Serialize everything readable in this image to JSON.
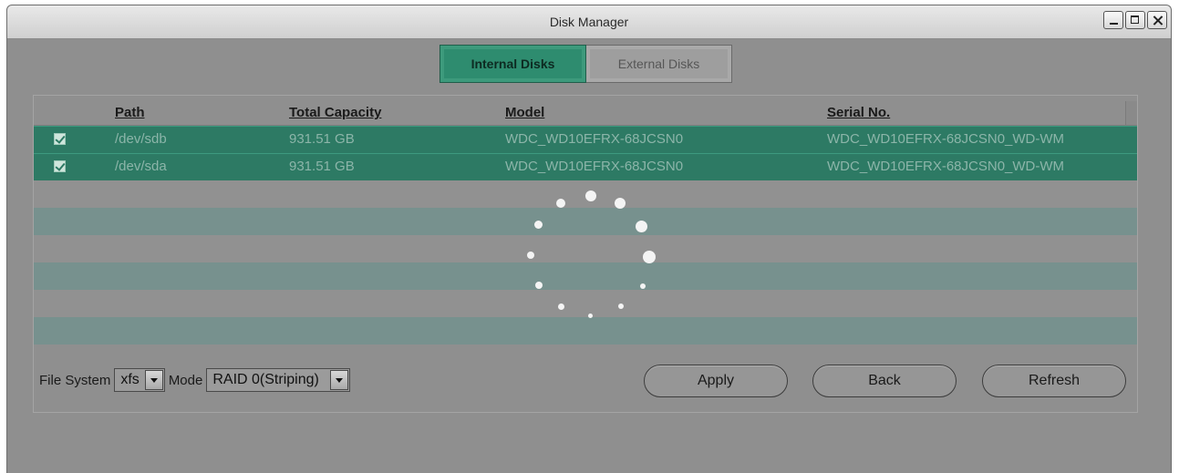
{
  "window": {
    "title": "Disk Manager"
  },
  "tabs": [
    {
      "label": "Internal Disks",
      "active": true
    },
    {
      "label": "External Disks",
      "active": false
    }
  ],
  "table": {
    "columns": [
      "Path",
      "Total Capacity",
      "Model",
      "Serial No."
    ],
    "rows": [
      {
        "checked": true,
        "path": "/dev/sdb",
        "capacity": "931.51 GB",
        "model": "WDC_WD10EFRX-68JCSN0",
        "serial": "WDC_WD10EFRX-68JCSN0_WD-WM"
      },
      {
        "checked": true,
        "path": "/dev/sda",
        "capacity": "931.51 GB",
        "model": "WDC_WD10EFRX-68JCSN0",
        "serial": "WDC_WD10EFRX-68JCSN0_WD-WM"
      }
    ]
  },
  "controls": {
    "file_system_label": "File System",
    "file_system_value": "xfs",
    "mode_label": "Mode",
    "mode_value": "RAID 0(Striping)"
  },
  "buttons": {
    "apply": "Apply",
    "back": "Back",
    "refresh": "Refresh"
  },
  "icons": {
    "loading": "loading-spinner-icon",
    "checkbox": "checkbox-checked-icon"
  },
  "colors": {
    "accent": "#2e8c6f",
    "selected_row": "#2d7a64",
    "overlay": "#8f8f8f"
  }
}
